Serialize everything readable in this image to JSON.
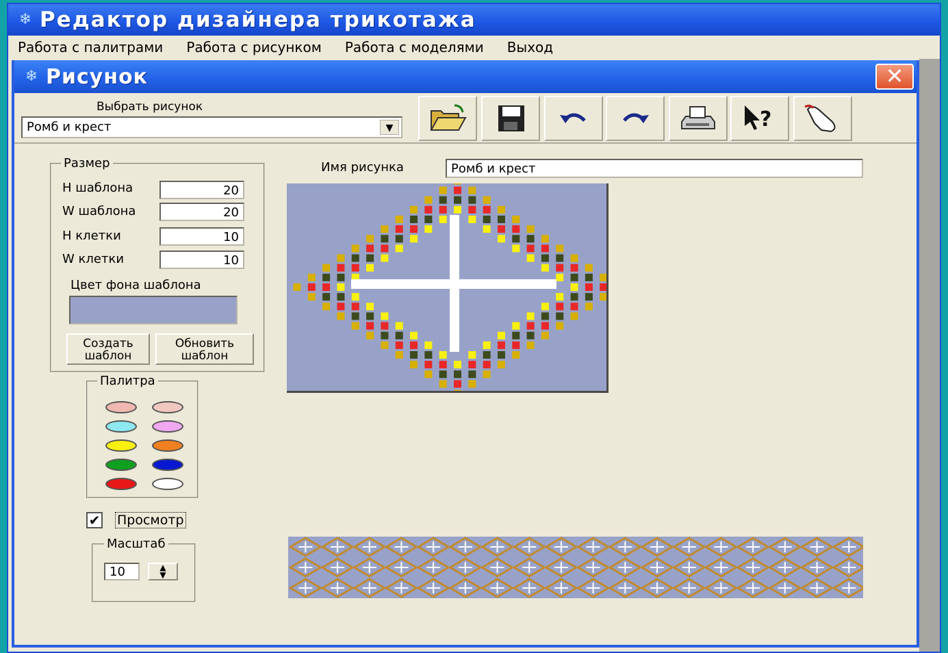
{
  "app": {
    "title": "Редактор дизайнера трикотажа",
    "menu": [
      "Работа с палитрами",
      "Работа с рисунком",
      "Работа с моделями",
      "Выход"
    ]
  },
  "child": {
    "title": "Рисунок",
    "select_label": "Выбрать рисунок",
    "selected_picture": "Ромб и крест",
    "toolbar": [
      {
        "icon": "open-folder-icon"
      },
      {
        "icon": "save-disk-icon"
      },
      {
        "icon": "undo-icon"
      },
      {
        "icon": "redo-icon"
      },
      {
        "icon": "print-icon"
      },
      {
        "icon": "help-pointer-icon"
      },
      {
        "icon": "exit-hand-icon"
      }
    ]
  },
  "size": {
    "legend": "Размер",
    "fields": [
      {
        "label": "Н шаблона",
        "value": "20"
      },
      {
        "label": "W шаблона",
        "value": "20"
      },
      {
        "label": "Н клетки",
        "value": "10"
      },
      {
        "label": "W клетки",
        "value": "10"
      }
    ],
    "bg_color_label": "Цвет фона шаблона",
    "bg_color": "#98a2c8",
    "create_label": "Создать шаблон",
    "update_label": "Обновить шаблон"
  },
  "palette": {
    "legend": "Палитра",
    "colors": [
      "#f0b8b0",
      "#f0c8c0",
      "#8ee8f0",
      "#f0a8f0",
      "#f8f010",
      "#f08020",
      "#10a020",
      "#0818d0",
      "#e81818",
      "#ffffff"
    ]
  },
  "preview": {
    "label": "Просмотр",
    "checked": true
  },
  "scale": {
    "legend": "Масштаб",
    "value": "10"
  },
  "picture": {
    "name_label": "Имя рисунка",
    "name_value": "Ромб и крест",
    "background": "#98a2c8",
    "rhombus_colors": [
      "#d8b000",
      "#3d4a1c",
      "#e82828",
      "#f8f010"
    ],
    "cross_color": "#ffffff"
  }
}
